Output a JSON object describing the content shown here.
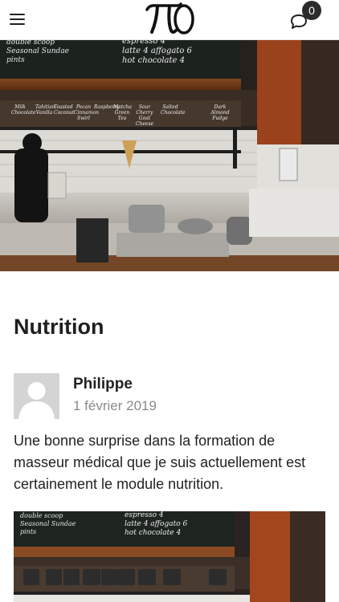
{
  "header": {
    "menu_icon": "hamburger-menu-icon",
    "logo_text": "πO",
    "comments_icon": "comment-bubbles-icon",
    "comments_count": "0"
  },
  "hero": {
    "board_left": [
      "double scoop",
      "Seasonal Sundae",
      "pints"
    ],
    "board_center": [
      "espresso",
      "latte",
      "affogato",
      "hot chocolate"
    ],
    "board_prices": [
      "4",
      "4",
      "6",
      "4"
    ],
    "jars": [
      "Milk Chocolate",
      "Tahitian Vanilla",
      "Toasted Coconut",
      "Pecan Cinnamon Swirl",
      "Raspberry",
      "Matcha Green Tea",
      "Sour Cherry Goat Cheese",
      "Salted Chocolate",
      "Dark Almond Fudge"
    ]
  },
  "post": {
    "title": "Nutrition",
    "author": "Philippe",
    "date": "1 février 2019",
    "excerpt": "Une bonne surprise dans la formation de masseur médical que je suis actuellement est certainement le module nutrition."
  },
  "colors": {
    "header_bg": "#ffffff",
    "badge_bg": "#2b2b2b",
    "title": "#1f1f1f",
    "date": "#8a8a8a",
    "avatar_bg": "#d3d3d3"
  }
}
